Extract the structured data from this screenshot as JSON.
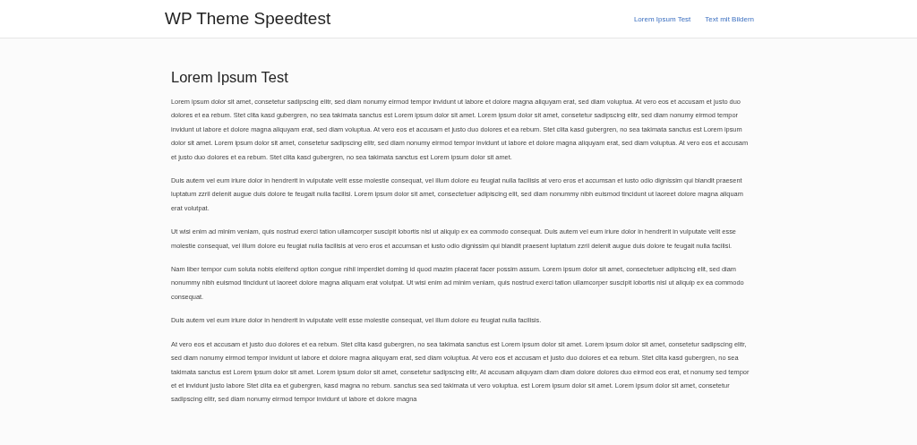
{
  "header": {
    "site_title": "WP Theme Speedtest",
    "nav": [
      {
        "label": "Lorem Ipsum Test"
      },
      {
        "label": "Text mit Bildern"
      }
    ]
  },
  "article": {
    "title": "Lorem Ipsum Test",
    "paragraphs": [
      "Lorem ipsum dolor sit amet, consetetur sadipscing elitr, sed diam nonumy eirmod tempor invidunt ut labore et dolore magna aliquyam erat, sed diam voluptua. At vero eos et accusam et justo duo dolores et ea rebum. Stet clita kasd gubergren, no sea takimata sanctus est Lorem ipsum dolor sit amet. Lorem ipsum dolor sit amet, consetetur sadipscing elitr, sed diam nonumy eirmod tempor invidunt ut labore et dolore magna aliquyam erat, sed diam voluptua. At vero eos et accusam et justo duo dolores et ea rebum. Stet clita kasd gubergren, no sea takimata sanctus est Lorem ipsum dolor sit amet. Lorem ipsum dolor sit amet, consetetur sadipscing elitr, sed diam nonumy eirmod tempor invidunt ut labore et dolore magna aliquyam erat, sed diam voluptua. At vero eos et accusam et justo duo dolores et ea rebum. Stet clita kasd gubergren, no sea takimata sanctus est Lorem ipsum dolor sit amet.",
      "Duis autem vel eum iriure dolor in hendrerit in vulputate velit esse molestie consequat, vel illum dolore eu feugiat nulla facilisis at vero eros et accumsan et iusto odio dignissim qui blandit praesent luptatum zzril delenit augue duis dolore te feugait nulla facilisi. Lorem ipsum dolor sit amet, consectetuer adipiscing elit, sed diam nonummy nibh euismod tincidunt ut laoreet dolore magna aliquam erat volutpat.",
      "Ut wisi enim ad minim veniam, quis nostrud exerci tation ullamcorper suscipit lobortis nisl ut aliquip ex ea commodo consequat. Duis autem vel eum iriure dolor in hendrerit in vulputate velit esse molestie consequat, vel illum dolore eu feugiat nulla facilisis at vero eros et accumsan et iusto odio dignissim qui blandit praesent luptatum zzril delenit augue duis dolore te feugait nulla facilisi.",
      "Nam liber tempor cum soluta nobis eleifend option congue nihil imperdiet doming id quod mazim placerat facer possim assum. Lorem ipsum dolor sit amet, consectetuer adipiscing elit, sed diam nonummy nibh euismod tincidunt ut laoreet dolore magna aliquam erat volutpat. Ut wisi enim ad minim veniam, quis nostrud exerci tation ullamcorper suscipit lobortis nisl ut aliquip ex ea commodo consequat.",
      "Duis autem vel eum iriure dolor in hendrerit in vulputate velit esse molestie consequat, vel illum dolore eu feugiat nulla facilisis.",
      "At vero eos et accusam et justo duo dolores et ea rebum. Stet clita kasd gubergren, no sea takimata sanctus est Lorem ipsum dolor sit amet. Lorem ipsum dolor sit amet, consetetur sadipscing elitr, sed diam nonumy eirmod tempor invidunt ut labore et dolore magna aliquyam erat, sed diam voluptua. At vero eos et accusam et justo duo dolores et ea rebum. Stet clita kasd gubergren, no sea takimata sanctus est Lorem ipsum dolor sit amet. Lorem ipsum dolor sit amet, consetetur sadipscing elitr, At accusam aliquyam diam diam dolore dolores duo eirmod eos erat, et nonumy sed tempor et et invidunt justo labore Stet clita ea et gubergren, kasd magna no rebum. sanctus sea sed takimata ut vero voluptua. est Lorem ipsum dolor sit amet. Lorem ipsum dolor sit amet, consetetur sadipscing elitr, sed diam nonumy eirmod tempor invidunt ut labore et dolore magna"
    ]
  }
}
